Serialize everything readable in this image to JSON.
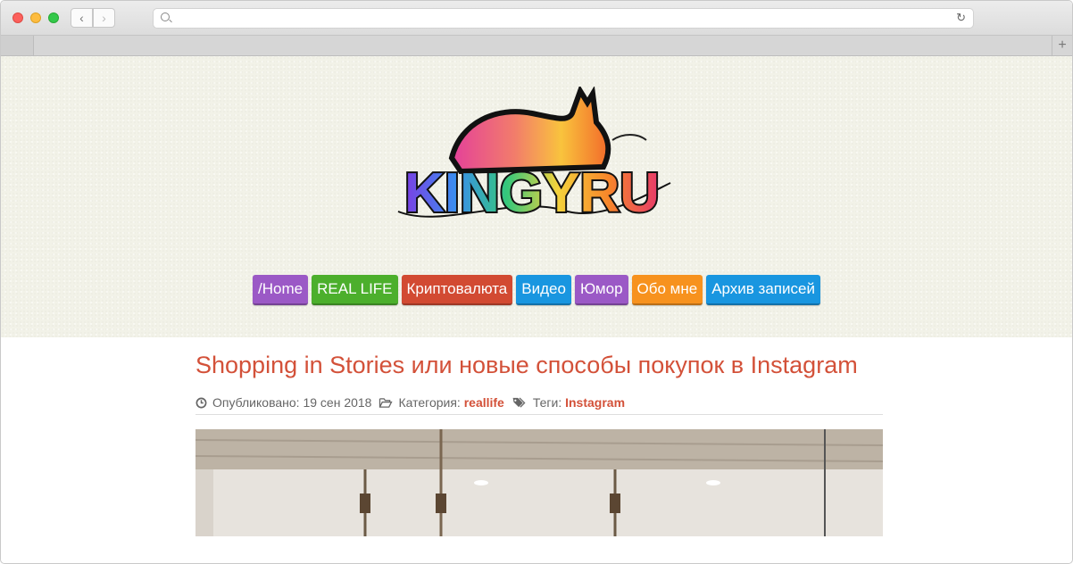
{
  "browser": {
    "url": "",
    "back_icon": "chevron-left-icon",
    "forward_icon": "chevron-right-icon",
    "reload_icon": "reload-icon",
    "new_tab_label": "+"
  },
  "site": {
    "logo_text": "KINGYRU",
    "menu": [
      {
        "label": "/Home",
        "color": "#9b59c6"
      },
      {
        "label": "REAL LIFE",
        "color": "#4caf2c"
      },
      {
        "label": "Криптовалюта",
        "color": "#d24a32"
      },
      {
        "label": "Видео",
        "color": "#1996e0"
      },
      {
        "label": "Юмор",
        "color": "#9b59c6"
      },
      {
        "label": "Обо мне",
        "color": "#f7921e"
      },
      {
        "label": "Архив записей",
        "color": "#1996e0"
      }
    ]
  },
  "post": {
    "title": "Shopping in Stories или новые способы покупок в Instagram",
    "published_label": "Опубликовано:",
    "published_date": "19 сен 2018",
    "category_label": "Категория:",
    "category": "reallife",
    "tags_label": "Теги:",
    "tag": "Instagram"
  },
  "colors": {
    "accent": "#d35139",
    "header_bg": "#f2f2e8"
  }
}
